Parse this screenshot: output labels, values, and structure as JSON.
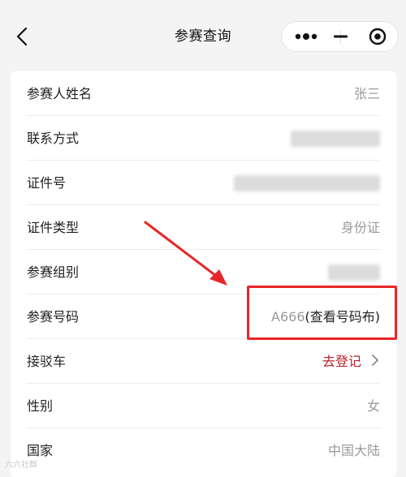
{
  "nav": {
    "title": "参赛查询"
  },
  "fields": [
    {
      "label": "参赛人姓名",
      "value": "张三"
    },
    {
      "label": "联系方式",
      "value": ""
    },
    {
      "label": "证件号",
      "value": ""
    },
    {
      "label": "证件类型",
      "value": "身份证"
    },
    {
      "label": "参赛组别",
      "value": ""
    },
    {
      "label": "参赛号码",
      "bib_number": "A666",
      "bib_link": "(查看号码布)"
    },
    {
      "label": "接驳车",
      "action": "去登记"
    },
    {
      "label": "性别",
      "value": "女"
    },
    {
      "label": "国家",
      "value": "中国大陆"
    }
  ],
  "colors": {
    "accent_red": "#b3202a",
    "annotation_red": "#e8262a"
  },
  "watermark": "六六社群"
}
